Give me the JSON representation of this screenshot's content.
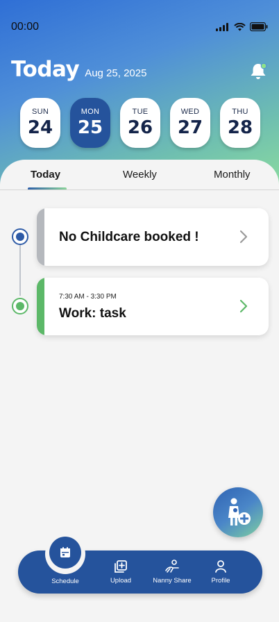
{
  "status_bar": {
    "time": "00:00"
  },
  "header": {
    "title": "Today",
    "date": "Aug 25, 2025"
  },
  "days": [
    {
      "name": "SUN",
      "num": "24",
      "active": false
    },
    {
      "name": "MON",
      "num": "25",
      "active": true
    },
    {
      "name": "TUE",
      "num": "26",
      "active": false
    },
    {
      "name": "WED",
      "num": "27",
      "active": false
    },
    {
      "name": "THU",
      "num": "28",
      "active": false
    }
  ],
  "tabs": [
    {
      "label": "Today",
      "active": true
    },
    {
      "label": "Weekly",
      "active": false
    },
    {
      "label": "Monthly",
      "active": false
    }
  ],
  "timeline": [
    {
      "title": "No Childcare booked !",
      "time": "",
      "accent": "#b5b8bd",
      "dot": "#2d5aa6"
    },
    {
      "title": "Work: task",
      "time": "7:30 AM - 3:30 PM",
      "accent": "#5cb868",
      "dot": "#5cb868"
    }
  ],
  "nav": [
    {
      "label": "Schedule",
      "icon": "calendar-icon"
    },
    {
      "label": "Upload",
      "icon": "upload-plus-icon"
    },
    {
      "label": "Nanny Share",
      "icon": "nanny-share-icon"
    },
    {
      "label": "Profile",
      "icon": "profile-icon"
    }
  ],
  "colors": {
    "primary": "#25539c",
    "green": "#5cb868",
    "notification_dot": "#8ee28a"
  }
}
